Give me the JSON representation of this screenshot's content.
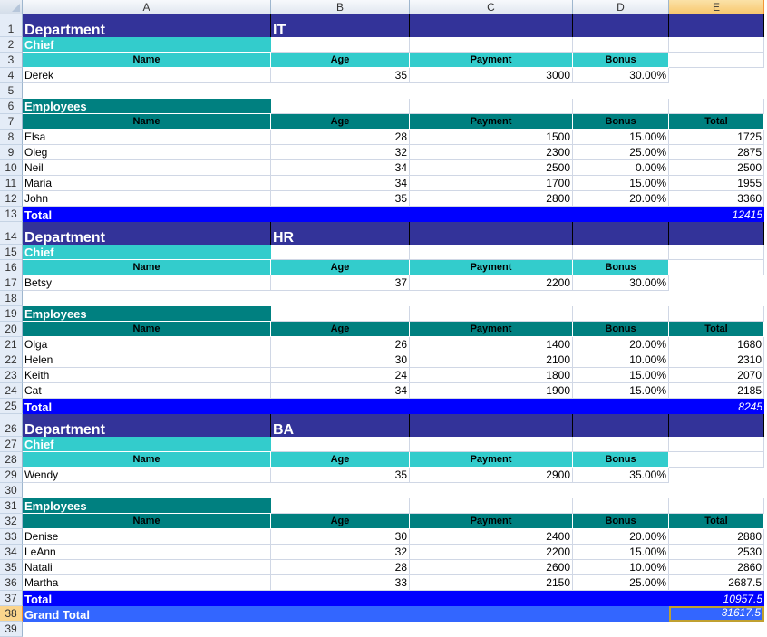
{
  "columns": [
    "A",
    "B",
    "C",
    "D",
    "E"
  ],
  "selected_cell": "E38",
  "labels": {
    "department": "Department",
    "chief": "Chief",
    "employees": "Employees",
    "total": "Total",
    "grand_total": "Grand Total"
  },
  "headers": {
    "name": "Name",
    "age": "Age",
    "payment": "Payment",
    "bonus": "Bonus",
    "total": "Total"
  },
  "departments": [
    {
      "name": "IT",
      "chief": {
        "name": "Derek",
        "age": "35",
        "payment": "3000",
        "bonus": "30.00%"
      },
      "employees": [
        {
          "name": "Elsa",
          "age": "28",
          "payment": "1500",
          "bonus": "15.00%",
          "total": "1725"
        },
        {
          "name": "Oleg",
          "age": "32",
          "payment": "2300",
          "bonus": "25.00%",
          "total": "2875"
        },
        {
          "name": "Neil",
          "age": "34",
          "payment": "2500",
          "bonus": "0.00%",
          "total": "2500"
        },
        {
          "name": "Maria",
          "age": "34",
          "payment": "1700",
          "bonus": "15.00%",
          "total": "1955"
        },
        {
          "name": "John",
          "age": "35",
          "payment": "2800",
          "bonus": "20.00%",
          "total": "3360"
        }
      ],
      "total": "12415"
    },
    {
      "name": "HR",
      "chief": {
        "name": "Betsy",
        "age": "37",
        "payment": "2200",
        "bonus": "30.00%"
      },
      "employees": [
        {
          "name": "Olga",
          "age": "26",
          "payment": "1400",
          "bonus": "20.00%",
          "total": "1680"
        },
        {
          "name": "Helen",
          "age": "30",
          "payment": "2100",
          "bonus": "10.00%",
          "total": "2310"
        },
        {
          "name": "Keith",
          "age": "24",
          "payment": "1800",
          "bonus": "15.00%",
          "total": "2070"
        },
        {
          "name": "Cat",
          "age": "34",
          "payment": "1900",
          "bonus": "15.00%",
          "total": "2185"
        }
      ],
      "total": "8245"
    },
    {
      "name": "BA",
      "chief": {
        "name": "Wendy",
        "age": "35",
        "payment": "2900",
        "bonus": "35.00%"
      },
      "employees": [
        {
          "name": "Denise",
          "age": "30",
          "payment": "2400",
          "bonus": "20.00%",
          "total": "2880"
        },
        {
          "name": "LeAnn",
          "age": "32",
          "payment": "2200",
          "bonus": "15.00%",
          "total": "2530"
        },
        {
          "name": "Natali",
          "age": "28",
          "payment": "2600",
          "bonus": "10.00%",
          "total": "2860"
        },
        {
          "name": "Martha",
          "age": "33",
          "payment": "2150",
          "bonus": "25.00%",
          "total": "2687.5"
        }
      ],
      "total": "10957.5"
    }
  ],
  "grand_total": "31617.5"
}
